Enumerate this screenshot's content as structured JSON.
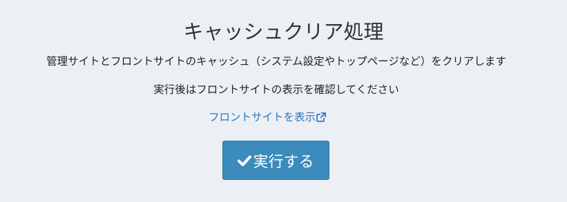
{
  "page": {
    "title": "キャッシュクリア処理",
    "description": "管理サイトとフロントサイトのキャッシュ（システム設定やトップページなど）をクリアします",
    "note": "実行後はフロントサイトの表示を確認してください",
    "link_label": "フロントサイトを表示",
    "link_icon": "external-link-icon",
    "execute_label": "実行する",
    "execute_icon": "check-icon"
  },
  "colors": {
    "background": "#eceff4",
    "link": "#2a78c4",
    "button": "#3b8bbd"
  }
}
